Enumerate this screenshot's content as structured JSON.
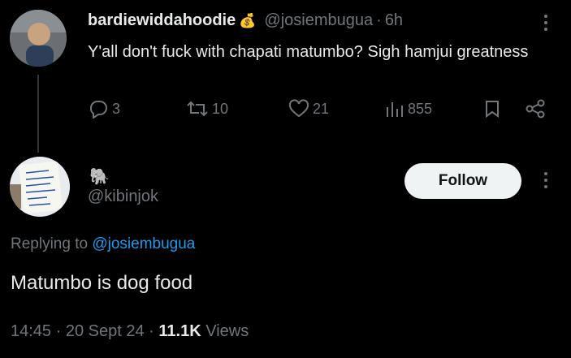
{
  "tweet": {
    "name": "bardiewiddahoodie",
    "name_emoji": "💰",
    "handle": "@josiembugua",
    "separator": "·",
    "time": "6h",
    "text": "Y'all don't fuck with chapati matumbo? Sigh hamjui greatness",
    "replies": "3",
    "retweets": "10",
    "likes": "21",
    "views": "855"
  },
  "reply": {
    "name_emoji": "🐘",
    "handle": "@kibinjok",
    "follow_label": "Follow",
    "replying_prefix": "Replying to ",
    "replying_handle": "@josiembugua",
    "text": "Matumbo is dog food",
    "time": "14:45",
    "date": "20 Sept 24",
    "views_count": "11.1K",
    "views_label": "Views",
    "dot": "·"
  },
  "colors": {
    "background": "#000000",
    "text_primary": "#e7e9ea",
    "text_secondary": "#71767b",
    "link": "#1d9bf0",
    "follow_bg": "#eff3f4"
  }
}
